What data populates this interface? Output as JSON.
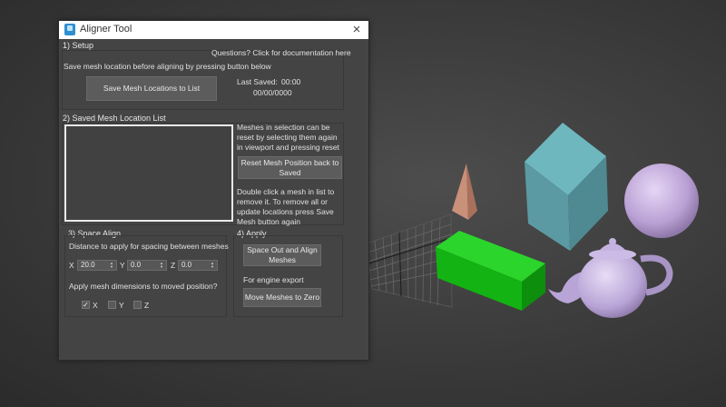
{
  "window": {
    "title": "Aligner Tool",
    "close_glyph": "×"
  },
  "setup": {
    "label": "1) Setup",
    "doc_link": "Questions? Click for documentation here",
    "instruction": "Save mesh location before aligning by pressing button below",
    "save_button": "Save Mesh Locations to List",
    "last_saved_label": "Last Saved:",
    "last_saved_time": "00:00",
    "last_saved_date": "00/00/0000"
  },
  "saved_list": {
    "label": "2) Saved Mesh Location List",
    "reset_help": "Meshes in selection can be reset by selecting them again in viewport and pressing reset",
    "reset_button": "Reset Mesh Position back to Saved",
    "remove_help": "Double click a mesh in list to remove it. To remove all or update locations press Save Mesh button again"
  },
  "space_align": {
    "label": "3) Space Align",
    "distance_label": "Distance to apply for spacing between meshes",
    "x_label": "X",
    "y_label": "Y",
    "z_label": "Z",
    "x_value": "20.0",
    "y_value": "0.0",
    "z_value": "0.0",
    "apply_dims_label": "Apply mesh dimensions to moved position?",
    "checks": [
      {
        "label": "X",
        "checked": true
      },
      {
        "label": "Y",
        "checked": false
      },
      {
        "label": "Z",
        "checked": false
      }
    ]
  },
  "apply": {
    "label": "4) Apply",
    "space_button": "Space Out and Align Meshes",
    "engine_label": "For engine export",
    "zero_button": "Move Meshes to Zero"
  },
  "colors": {
    "box": "#5f9ea6",
    "cone": "#c9907a",
    "sphere": "#c9b2e0",
    "teapot": "#c7b6e2",
    "green_box": "#12c312"
  }
}
